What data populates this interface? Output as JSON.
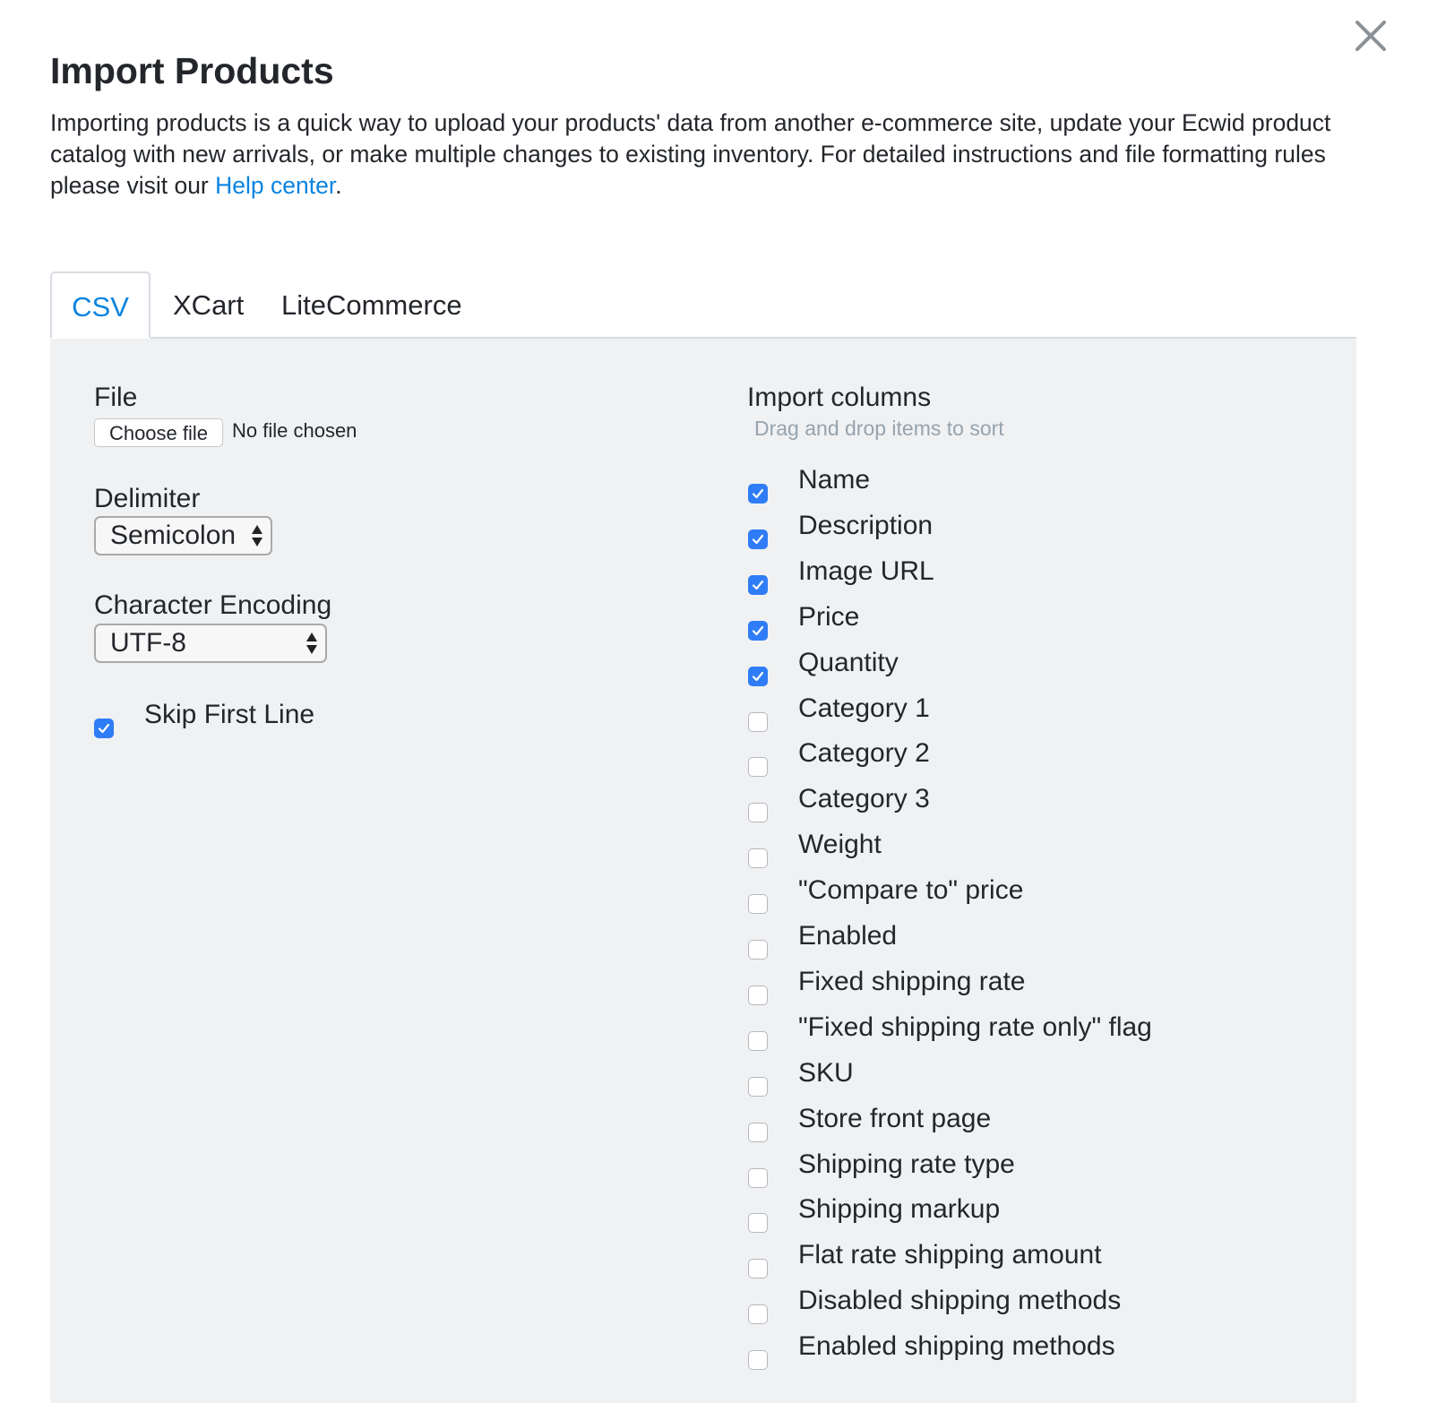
{
  "dialog": {
    "title": "Import Products",
    "description": "Importing products is a quick way to upload your products' data from another e-commerce site, update your Ecwid product catalog with new arrivals, or make multiple changes to existing inventory. For detailed instructions and file formatting rules please visit our ",
    "help_link": "Help center",
    "description_end": ".",
    "close_icon": "close-icon"
  },
  "tabs": [
    {
      "label": "CSV",
      "active": true
    },
    {
      "label": "XCart",
      "active": false
    },
    {
      "label": "LiteCommerce",
      "active": false
    }
  ],
  "accent_color": "#0a84e0",
  "form": {
    "file_label": "File",
    "choose_file": "Choose file",
    "no_file": "No file chosen",
    "delimiter_label": "Delimiter",
    "delimiter_value": "Semicolon",
    "encoding_label": "Character Encoding",
    "encoding_value": "UTF-8",
    "skip_first_line": {
      "label": "Skip First Line",
      "checked": true
    }
  },
  "columns": {
    "title": "Import columns",
    "hint": "Drag and drop items to sort",
    "items": [
      {
        "label": "Name",
        "checked": true
      },
      {
        "label": "Description",
        "checked": true
      },
      {
        "label": "Image URL",
        "checked": true
      },
      {
        "label": "Price",
        "checked": true
      },
      {
        "label": "Quantity",
        "checked": true
      },
      {
        "label": "Category 1",
        "checked": false
      },
      {
        "label": "Category 2",
        "checked": false
      },
      {
        "label": "Category 3",
        "checked": false
      },
      {
        "label": "Weight",
        "checked": false
      },
      {
        "label": "\"Compare to\" price",
        "checked": false
      },
      {
        "label": "Enabled",
        "checked": false
      },
      {
        "label": "Fixed shipping rate",
        "checked": false
      },
      {
        "label": "\"Fixed shipping rate only\" flag",
        "checked": false
      },
      {
        "label": "SKU",
        "checked": false
      },
      {
        "label": "Store front page",
        "checked": false
      },
      {
        "label": "Shipping rate type",
        "checked": false
      },
      {
        "label": "Shipping markup",
        "checked": false
      },
      {
        "label": "Flat rate shipping amount",
        "checked": false
      },
      {
        "label": "Disabled shipping methods",
        "checked": false
      },
      {
        "label": "Enabled shipping methods",
        "checked": false
      }
    ]
  }
}
